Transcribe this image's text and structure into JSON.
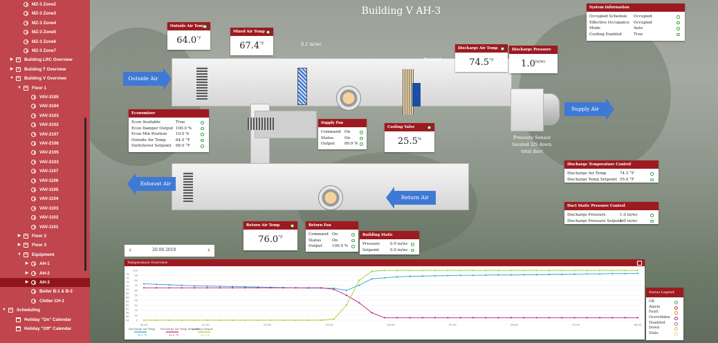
{
  "sidebar": {
    "items": [
      {
        "label": "MZ-3 Zone2",
        "indent": 2,
        "icon": "clock",
        "expand": ""
      },
      {
        "label": "MZ-3 Zone3",
        "indent": 2,
        "icon": "clock",
        "expand": ""
      },
      {
        "label": "MZ-3 Zone4",
        "indent": 2,
        "icon": "clock",
        "expand": ""
      },
      {
        "label": "MZ-3 Zone5",
        "indent": 2,
        "icon": "clock",
        "expand": ""
      },
      {
        "label": "MZ-3 Zone6",
        "indent": 2,
        "icon": "clock",
        "expand": ""
      },
      {
        "label": "MZ-3 Zone7",
        "indent": 2,
        "icon": "clock",
        "expand": ""
      },
      {
        "label": "Building LRC Overview",
        "indent": 1,
        "icon": "folder",
        "expand": "right"
      },
      {
        "label": "Building T Overview",
        "indent": 1,
        "icon": "folder",
        "expand": "right"
      },
      {
        "label": "Building V Overview",
        "indent": 1,
        "icon": "folder",
        "expand": "down"
      },
      {
        "label": "Floor 1",
        "indent": 2,
        "icon": "folder",
        "expand": "down"
      },
      {
        "label": "VAV-3105",
        "indent": 3,
        "icon": "clock",
        "expand": ""
      },
      {
        "label": "VAV-3104",
        "indent": 3,
        "icon": "clock",
        "expand": ""
      },
      {
        "label": "VAV-3103",
        "indent": 3,
        "icon": "clock",
        "expand": ""
      },
      {
        "label": "VAV-3102",
        "indent": 3,
        "icon": "clock",
        "expand": ""
      },
      {
        "label": "VAV-2107",
        "indent": 3,
        "icon": "clock",
        "expand": ""
      },
      {
        "label": "VAV-2106",
        "indent": 3,
        "icon": "clock",
        "expand": ""
      },
      {
        "label": "VAV-2105",
        "indent": 3,
        "icon": "clock",
        "expand": ""
      },
      {
        "label": "VAV-2103",
        "indent": 3,
        "icon": "clock",
        "expand": ""
      },
      {
        "label": "VAV-1107",
        "indent": 3,
        "icon": "clock",
        "expand": ""
      },
      {
        "label": "VAV-1106",
        "indent": 3,
        "icon": "clock",
        "expand": ""
      },
      {
        "label": "VAV-1105",
        "indent": 3,
        "icon": "clock",
        "expand": ""
      },
      {
        "label": "VAV-1104",
        "indent": 3,
        "icon": "clock",
        "expand": ""
      },
      {
        "label": "VAV-1103",
        "indent": 3,
        "icon": "clock",
        "expand": ""
      },
      {
        "label": "VAV-1102",
        "indent": 3,
        "icon": "clock",
        "expand": ""
      },
      {
        "label": "VAV-1101",
        "indent": 3,
        "icon": "clock",
        "expand": ""
      },
      {
        "label": "Floor 2",
        "indent": 2,
        "icon": "folder",
        "expand": "right"
      },
      {
        "label": "Floor 3",
        "indent": 2,
        "icon": "folder",
        "expand": "right"
      },
      {
        "label": "Equipment",
        "indent": 2,
        "icon": "folder",
        "expand": "down"
      },
      {
        "label": "AH-1",
        "indent": 3,
        "icon": "clock",
        "expand": "right"
      },
      {
        "label": "AH-2",
        "indent": 3,
        "icon": "clock",
        "expand": "right"
      },
      {
        "label": "AH-3",
        "indent": 3,
        "icon": "clock",
        "expand": "right",
        "selected": true
      },
      {
        "label": "Boiler B-1 & B-2",
        "indent": 3,
        "icon": "clock",
        "expand": ""
      },
      {
        "label": "Chiller CH-1",
        "indent": 3,
        "icon": "clock",
        "expand": ""
      },
      {
        "label": "Scheduling",
        "indent": 0,
        "icon": "folder",
        "expand": "down"
      },
      {
        "label": "Holiday \"On\" Calendar",
        "indent": 1,
        "icon": "cal",
        "expand": ""
      },
      {
        "label": "Holiday \"Off\" Calendar",
        "indent": 1,
        "icon": "cal",
        "expand": ""
      }
    ]
  },
  "page": {
    "title": "Building V AH-3"
  },
  "system_info": {
    "title": "System Information",
    "rows": [
      {
        "label": "Occupied Schedule",
        "value": "Occupied"
      },
      {
        "label": "Effective Occupancy",
        "value": "Occupied"
      },
      {
        "label": "Mode",
        "value": "Auto"
      },
      {
        "label": "Cooling Enabled",
        "value": "True"
      }
    ]
  },
  "outside_air_temp": {
    "title": "Outside Air Temp",
    "value": "64.0",
    "unit": "°F"
  },
  "mixed_air_temp": {
    "title": "Mixed Air Temp",
    "value": "67.4",
    "unit": "°F"
  },
  "filter_pressure": {
    "value": "0.1 in/wc"
  },
  "filter_status": {
    "value": "Normal"
  },
  "discharge_air_temp": {
    "title": "Discharge Air Temp",
    "value": "74.5",
    "unit": "°F"
  },
  "discharge_pressure": {
    "title": "Discharge Pressure",
    "value": "1.0",
    "unit": "in/wc"
  },
  "pressure_sensor_note": "Pressure Sensor located 2/5 down total duct",
  "arrows": {
    "outside_air": "Outside Air",
    "supply_air": "Supply Air",
    "exhaust_air": "Exhaust Air",
    "return_air": "Return Air"
  },
  "economizer": {
    "title": "Economizer",
    "rows": [
      {
        "label": "Econ Available",
        "value": "True"
      },
      {
        "label": "Econ Damper Output",
        "value": "100.0 %"
      },
      {
        "label": "Econ Min Position",
        "value": "10.0 %"
      },
      {
        "label": "Outside Air Temp",
        "value": "64.0 °F"
      },
      {
        "label": "Switchover Setpoint",
        "value": "68.0 °F"
      }
    ]
  },
  "supply_fan": {
    "title": "Supply Fan",
    "rows": [
      {
        "label": "Command",
        "value": "On"
      },
      {
        "label": "Status",
        "value": "On"
      },
      {
        "label": "Output",
        "value": "89.9 %"
      }
    ]
  },
  "cooling_valve": {
    "title": "Cooling Valve",
    "value": "25.5",
    "unit": "%"
  },
  "discharge_temp_control": {
    "title": "Discharge Temperature Control",
    "rows": [
      {
        "label": "Discharge Air Temp",
        "value": "74.5 °F"
      },
      {
        "label": "Discharge Temp Setpoint",
        "value": "55.0 °F"
      }
    ]
  },
  "duct_static_control": {
    "title": "Duct Static Pressure Control",
    "rows": [
      {
        "label": "Discharge Pressure",
        "value": "1.0 in/wc"
      },
      {
        "label": "Discharge Pressure Setpoint",
        "value": "1.0 in/wc"
      }
    ]
  },
  "return_air_temp": {
    "title": "Return Air Temp",
    "value": "76.0",
    "unit": "°F"
  },
  "return_fan": {
    "title": "Return Fan",
    "rows": [
      {
        "label": "Command",
        "value": "On"
      },
      {
        "label": "Status",
        "value": "On"
      },
      {
        "label": "Output",
        "value": "100.0 %"
      }
    ]
  },
  "building_static": {
    "title": "Building Static",
    "rows": [
      {
        "label": "Pressure",
        "value": "0.0 in/wc"
      },
      {
        "label": "Setpoint",
        "value": "0.0 in/wc"
      }
    ]
  },
  "date_picker": {
    "value": "20.08.2018",
    "prev": "‹",
    "next": "›"
  },
  "trends": {
    "title": "Temperature Overview",
    "legend": [
      {
        "name": "Discharge Air Temp",
        "value": "74.5 °F",
        "color": "#2aa6c8"
      },
      {
        "name": "Discharge Air Temp Setpoint",
        "value": "55.0 °F",
        "color": "#c2188a"
      },
      {
        "name": "Cooling Output",
        "value": "25.5 %",
        "color": "#a8c82a"
      }
    ]
  },
  "status_legend": {
    "title": "Status Legend",
    "items": [
      {
        "label": "OK",
        "color": "#37a83f"
      },
      {
        "label": "Alarm",
        "color": "#d22c2c"
      },
      {
        "label": "Fault",
        "color": "#e08a1c"
      },
      {
        "label": "Overridden",
        "color": "#c0188a"
      },
      {
        "label": "Disabled",
        "color": "#9a6cc8"
      },
      {
        "label": "Down",
        "color": "#c8c82a"
      },
      {
        "label": "Stale",
        "color": "#e6d48a"
      }
    ]
  },
  "chart_data": {
    "type": "line",
    "title": "Temperature Overview",
    "x": [
      "00:00",
      "01:00",
      "02:00",
      "03:00",
      "04:00",
      "05:00",
      "06:00",
      "07:00",
      "08:00"
    ],
    "y_left_ticks": [
      "100",
      "90",
      "80",
      "70",
      "60",
      "50",
      "40",
      "30",
      "20",
      "10",
      "0"
    ],
    "y_right_ticks": [
      "",
      "78",
      "76",
      "74",
      "72",
      "70",
      "68",
      "66",
      "64",
      "62",
      "60",
      "58",
      "56",
      "54"
    ],
    "series": [
      {
        "name": "Discharge Air Temp",
        "color": "#2aa6c8",
        "axis": "left",
        "values": [
          73,
          72,
          71,
          70,
          69,
          68.5,
          68,
          67.5,
          67,
          66.5,
          66,
          65.5,
          65,
          64.5,
          64.5,
          64,
          60,
          70,
          83,
          85,
          87,
          88,
          88.5,
          89,
          89.5,
          90,
          90,
          90.5,
          91,
          91,
          91.5,
          91.5,
          92,
          92,
          92.5,
          93,
          93,
          93.5,
          93.5,
          94
        ]
      },
      {
        "name": "Discharge Air Temp Setpoint",
        "color": "#c2188a",
        "axis": "left",
        "values": [
          65,
          65,
          65,
          65,
          65,
          65,
          65,
          65,
          65,
          65,
          65,
          65,
          65,
          65,
          65,
          62,
          50,
          35,
          15,
          5,
          5,
          5,
          5,
          5,
          5,
          5,
          5,
          5,
          5,
          5,
          5,
          5,
          5,
          5,
          5,
          5,
          5,
          5,
          5,
          5
        ]
      },
      {
        "name": "Cooling Output",
        "color": "#a8c82a",
        "axis": "left",
        "values": [
          0,
          0,
          0,
          0,
          0,
          0,
          0,
          0,
          0,
          0,
          0,
          0,
          0,
          0,
          0,
          2,
          30,
          80,
          98,
          100,
          100,
          100,
          100,
          100,
          100,
          100,
          100,
          100,
          100,
          100,
          100,
          100,
          100,
          100,
          100,
          100,
          100,
          100,
          100,
          100
        ]
      }
    ],
    "ylim": [
      0,
      100
    ]
  }
}
